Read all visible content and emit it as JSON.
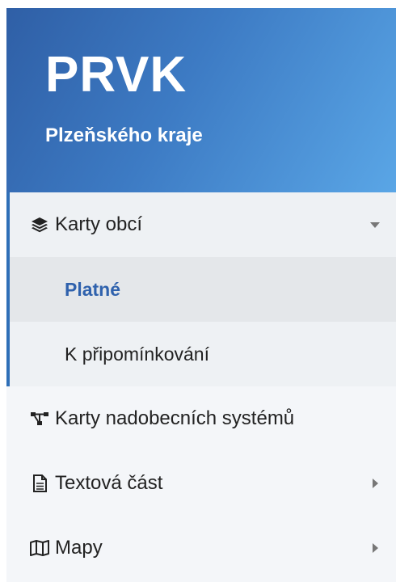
{
  "brand": {
    "title": "PRVK",
    "subtitle": "Plzeňského kraje"
  },
  "colors": {
    "header_start": "#2f5fa6",
    "header_end": "#5aa6e6",
    "active_text": "#2f62ad",
    "group_indicator": "#2f6fb7"
  },
  "menu": {
    "group": {
      "label": "Karty obcí",
      "icon": "layers-icon",
      "expanded": true,
      "children": [
        {
          "label": "Platné",
          "active": true
        },
        {
          "label": "K připomínkování",
          "active": false
        }
      ]
    },
    "items": [
      {
        "label": "Karty nadobecních systémů",
        "icon": "network-icon"
      },
      {
        "label": "Textová část",
        "icon": "document-icon"
      },
      {
        "label": "Mapy",
        "icon": "map-icon"
      }
    ]
  }
}
